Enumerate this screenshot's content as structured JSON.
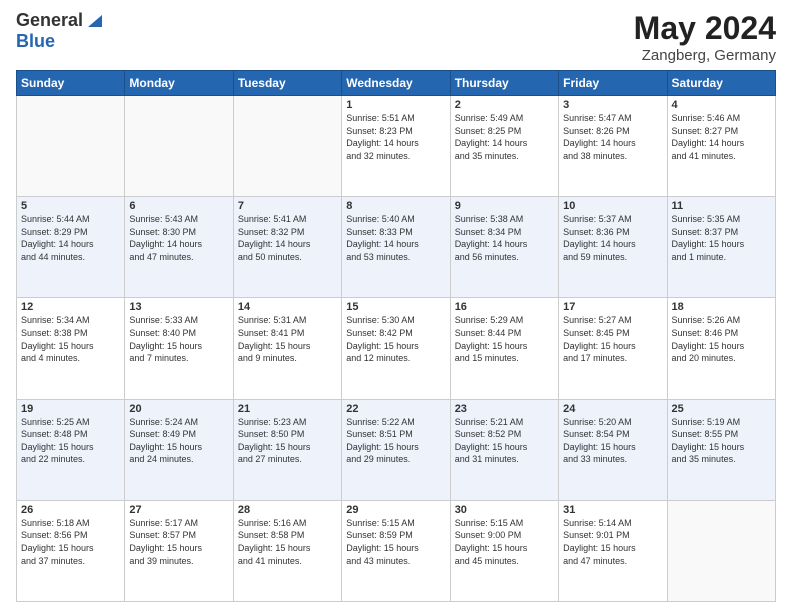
{
  "header": {
    "logo_general": "General",
    "logo_blue": "Blue",
    "title": "May 2024",
    "location": "Zangberg, Germany"
  },
  "days_of_week": [
    "Sunday",
    "Monday",
    "Tuesday",
    "Wednesday",
    "Thursday",
    "Friday",
    "Saturday"
  ],
  "weeks": [
    [
      {
        "day": "",
        "info": ""
      },
      {
        "day": "",
        "info": ""
      },
      {
        "day": "",
        "info": ""
      },
      {
        "day": "1",
        "info": "Sunrise: 5:51 AM\nSunset: 8:23 PM\nDaylight: 14 hours\nand 32 minutes."
      },
      {
        "day": "2",
        "info": "Sunrise: 5:49 AM\nSunset: 8:25 PM\nDaylight: 14 hours\nand 35 minutes."
      },
      {
        "day": "3",
        "info": "Sunrise: 5:47 AM\nSunset: 8:26 PM\nDaylight: 14 hours\nand 38 minutes."
      },
      {
        "day": "4",
        "info": "Sunrise: 5:46 AM\nSunset: 8:27 PM\nDaylight: 14 hours\nand 41 minutes."
      }
    ],
    [
      {
        "day": "5",
        "info": "Sunrise: 5:44 AM\nSunset: 8:29 PM\nDaylight: 14 hours\nand 44 minutes."
      },
      {
        "day": "6",
        "info": "Sunrise: 5:43 AM\nSunset: 8:30 PM\nDaylight: 14 hours\nand 47 minutes."
      },
      {
        "day": "7",
        "info": "Sunrise: 5:41 AM\nSunset: 8:32 PM\nDaylight: 14 hours\nand 50 minutes."
      },
      {
        "day": "8",
        "info": "Sunrise: 5:40 AM\nSunset: 8:33 PM\nDaylight: 14 hours\nand 53 minutes."
      },
      {
        "day": "9",
        "info": "Sunrise: 5:38 AM\nSunset: 8:34 PM\nDaylight: 14 hours\nand 56 minutes."
      },
      {
        "day": "10",
        "info": "Sunrise: 5:37 AM\nSunset: 8:36 PM\nDaylight: 14 hours\nand 59 minutes."
      },
      {
        "day": "11",
        "info": "Sunrise: 5:35 AM\nSunset: 8:37 PM\nDaylight: 15 hours\nand 1 minute."
      }
    ],
    [
      {
        "day": "12",
        "info": "Sunrise: 5:34 AM\nSunset: 8:38 PM\nDaylight: 15 hours\nand 4 minutes."
      },
      {
        "day": "13",
        "info": "Sunrise: 5:33 AM\nSunset: 8:40 PM\nDaylight: 15 hours\nand 7 minutes."
      },
      {
        "day": "14",
        "info": "Sunrise: 5:31 AM\nSunset: 8:41 PM\nDaylight: 15 hours\nand 9 minutes."
      },
      {
        "day": "15",
        "info": "Sunrise: 5:30 AM\nSunset: 8:42 PM\nDaylight: 15 hours\nand 12 minutes."
      },
      {
        "day": "16",
        "info": "Sunrise: 5:29 AM\nSunset: 8:44 PM\nDaylight: 15 hours\nand 15 minutes."
      },
      {
        "day": "17",
        "info": "Sunrise: 5:27 AM\nSunset: 8:45 PM\nDaylight: 15 hours\nand 17 minutes."
      },
      {
        "day": "18",
        "info": "Sunrise: 5:26 AM\nSunset: 8:46 PM\nDaylight: 15 hours\nand 20 minutes."
      }
    ],
    [
      {
        "day": "19",
        "info": "Sunrise: 5:25 AM\nSunset: 8:48 PM\nDaylight: 15 hours\nand 22 minutes."
      },
      {
        "day": "20",
        "info": "Sunrise: 5:24 AM\nSunset: 8:49 PM\nDaylight: 15 hours\nand 24 minutes."
      },
      {
        "day": "21",
        "info": "Sunrise: 5:23 AM\nSunset: 8:50 PM\nDaylight: 15 hours\nand 27 minutes."
      },
      {
        "day": "22",
        "info": "Sunrise: 5:22 AM\nSunset: 8:51 PM\nDaylight: 15 hours\nand 29 minutes."
      },
      {
        "day": "23",
        "info": "Sunrise: 5:21 AM\nSunset: 8:52 PM\nDaylight: 15 hours\nand 31 minutes."
      },
      {
        "day": "24",
        "info": "Sunrise: 5:20 AM\nSunset: 8:54 PM\nDaylight: 15 hours\nand 33 minutes."
      },
      {
        "day": "25",
        "info": "Sunrise: 5:19 AM\nSunset: 8:55 PM\nDaylight: 15 hours\nand 35 minutes."
      }
    ],
    [
      {
        "day": "26",
        "info": "Sunrise: 5:18 AM\nSunset: 8:56 PM\nDaylight: 15 hours\nand 37 minutes."
      },
      {
        "day": "27",
        "info": "Sunrise: 5:17 AM\nSunset: 8:57 PM\nDaylight: 15 hours\nand 39 minutes."
      },
      {
        "day": "28",
        "info": "Sunrise: 5:16 AM\nSunset: 8:58 PM\nDaylight: 15 hours\nand 41 minutes."
      },
      {
        "day": "29",
        "info": "Sunrise: 5:15 AM\nSunset: 8:59 PM\nDaylight: 15 hours\nand 43 minutes."
      },
      {
        "day": "30",
        "info": "Sunrise: 5:15 AM\nSunset: 9:00 PM\nDaylight: 15 hours\nand 45 minutes."
      },
      {
        "day": "31",
        "info": "Sunrise: 5:14 AM\nSunset: 9:01 PM\nDaylight: 15 hours\nand 47 minutes."
      },
      {
        "day": "",
        "info": ""
      }
    ]
  ]
}
